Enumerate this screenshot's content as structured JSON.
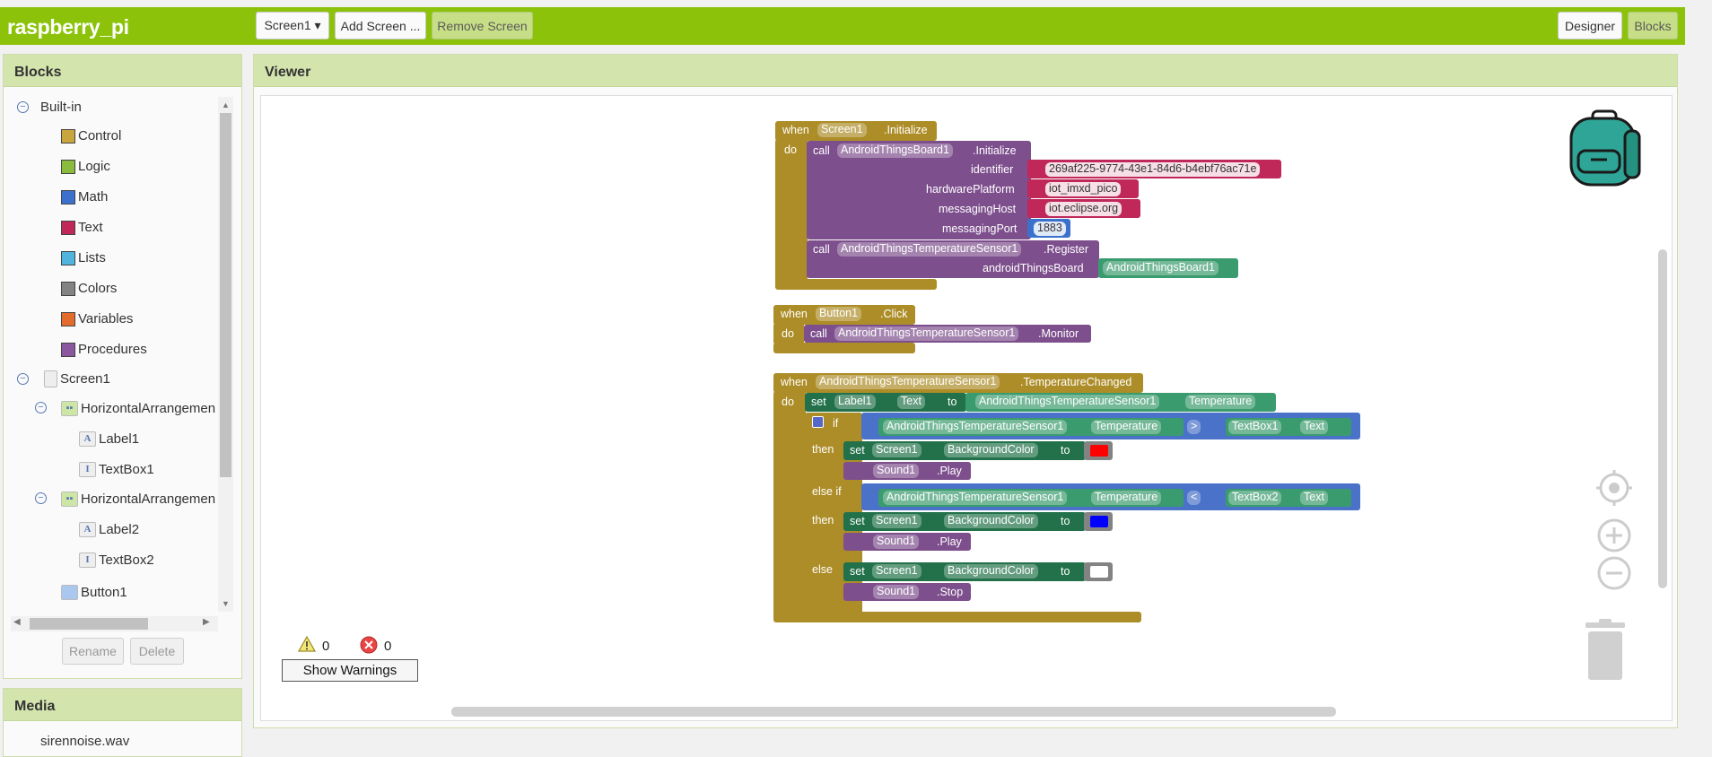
{
  "app": {
    "title": "raspberry_pi"
  },
  "toolbar": {
    "screen_select": "Screen1 ▾",
    "add_screen": "Add Screen ...",
    "remove_screen": "Remove Screen",
    "designer": "Designer",
    "blocks": "Blocks"
  },
  "blocks_panel": {
    "title": "Blocks",
    "builtin": "Built-in",
    "builtin_items": [
      {
        "label": "Control",
        "color": "#c9a53d"
      },
      {
        "label": "Logic",
        "color": "#8bbb3c"
      },
      {
        "label": "Math",
        "color": "#3b71cc"
      },
      {
        "label": "Text",
        "color": "#c1285a"
      },
      {
        "label": "Lists",
        "color": "#4fb5dd"
      },
      {
        "label": "Colors",
        "color": "#838383"
      },
      {
        "label": "Variables",
        "color": "#e36c2c"
      },
      {
        "label": "Procedures",
        "color": "#8b58a0"
      }
    ],
    "screen": "Screen1",
    "arrangement1": "HorizontalArrangemen",
    "label1": "Label1",
    "textbox1": "TextBox1",
    "arrangement2": "HorizontalArrangemen",
    "label2": "Label2",
    "textbox2": "TextBox2",
    "button1": "Button1",
    "rename": "Rename",
    "delete": "Delete"
  },
  "media": {
    "title": "Media",
    "file": "sirennoise.wav"
  },
  "viewer": {
    "title": "Viewer",
    "warnings_count": "0",
    "errors_count": "0",
    "show_warnings": "Show Warnings"
  },
  "workspace": {
    "b1": {
      "when": "when",
      "component": "Screen1",
      "event": ".Initialize",
      "do": "do",
      "call1": "call",
      "call1_component": "AndroidThingsBoard1",
      "call1_method": ".Initialize",
      "p_identifier": "identifier",
      "v_identifier": "269af225-9774-43e1-84d6-b4ebf76ac71e",
      "p_platform": "hardwarePlatform",
      "v_platform": "iot_imxd_pico",
      "p_host": "messagingHost",
      "v_host": "iot.eclipse.org",
      "p_port": "messagingPort",
      "v_port": "1883",
      "call2": "call",
      "call2_component": "AndroidThingsTemperatureSensor1",
      "call2_method": ".Register",
      "p_board": "androidThingsBoard",
      "v_board": "AndroidThingsBoard1"
    },
    "b2": {
      "when": "when",
      "component": "Button1",
      "event": ".Click",
      "do": "do",
      "call": "call",
      "call_component": "AndroidThingsTemperatureSensor1",
      "call_method": ".Monitor"
    },
    "b3": {
      "when": "when",
      "component": "AndroidThingsTemperatureSensor1",
      "event": ".TemperatureChanged",
      "do": "do",
      "set": "set",
      "set_component": "Label1",
      "set_prop": "Text",
      "to": "to",
      "get_component": "AndroidThingsTemperatureSensor1",
      "get_prop": "Temperature",
      "if": "if",
      "then": "then",
      "elseif": "else if",
      "else": "else",
      "cmp1_left_comp": "AndroidThingsTemperatureSensor1",
      "cmp1_left_prop": "Temperature",
      "cmp1_op": ">",
      "cmp1_right_comp": "TextBox1",
      "cmp1_right_prop": "Text",
      "cmp2_left_comp": "AndroidThingsTemperatureSensor1",
      "cmp2_left_prop": "Temperature",
      "cmp2_op": "<",
      "cmp2_right_comp": "TextBox2",
      "cmp2_right_prop": "Text",
      "screen": "Screen1",
      "bgcolor": "BackgroundColor",
      "sound": "Sound1",
      "play": ".Play",
      "stop": ".Stop",
      "color_red": "#ff0000",
      "color_blue": "#0000ff",
      "color_white": "#ffffff"
    }
  }
}
